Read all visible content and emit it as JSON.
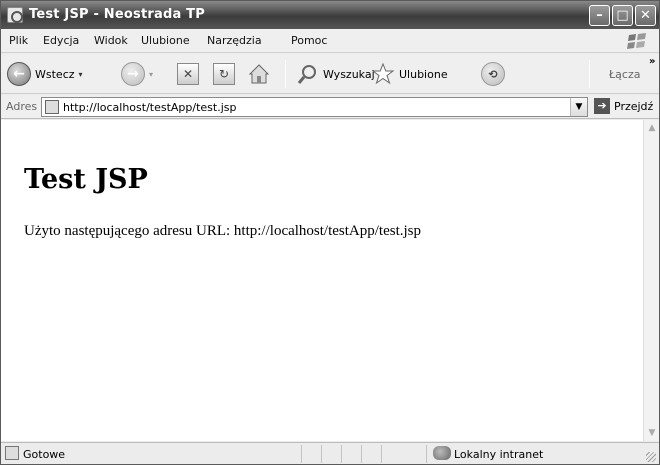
{
  "window": {
    "title": "Test JSP - Neostrada TP"
  },
  "menu": {
    "items": [
      "Plik",
      "Edycja",
      "Widok",
      "Ulubione",
      "Narzędzia",
      "Pomoc"
    ]
  },
  "toolbar": {
    "back_label": "Wstecz",
    "search_label": "Wyszukaj",
    "favorites_label": "Ulubione",
    "links_label": "Łącza"
  },
  "address": {
    "label": "Adres",
    "url": "http://localhost/testApp/test.jsp",
    "go_label": "Przejdź"
  },
  "page": {
    "heading": "Test JSP",
    "text": "Użyto następującego adresu URL: http://localhost/testApp/test.jsp"
  },
  "status": {
    "text": "Gotowe",
    "zone": "Lokalny intranet"
  },
  "icons": [
    "app-icon",
    "minimize-icon",
    "maximize-icon",
    "close-icon",
    "windows-logo-icon",
    "back-icon",
    "forward-icon",
    "stop-icon",
    "refresh-icon",
    "home-icon",
    "search-icon",
    "favorites-star-icon",
    "history-icon",
    "page-icon",
    "go-arrow-icon",
    "intranet-icon"
  ]
}
